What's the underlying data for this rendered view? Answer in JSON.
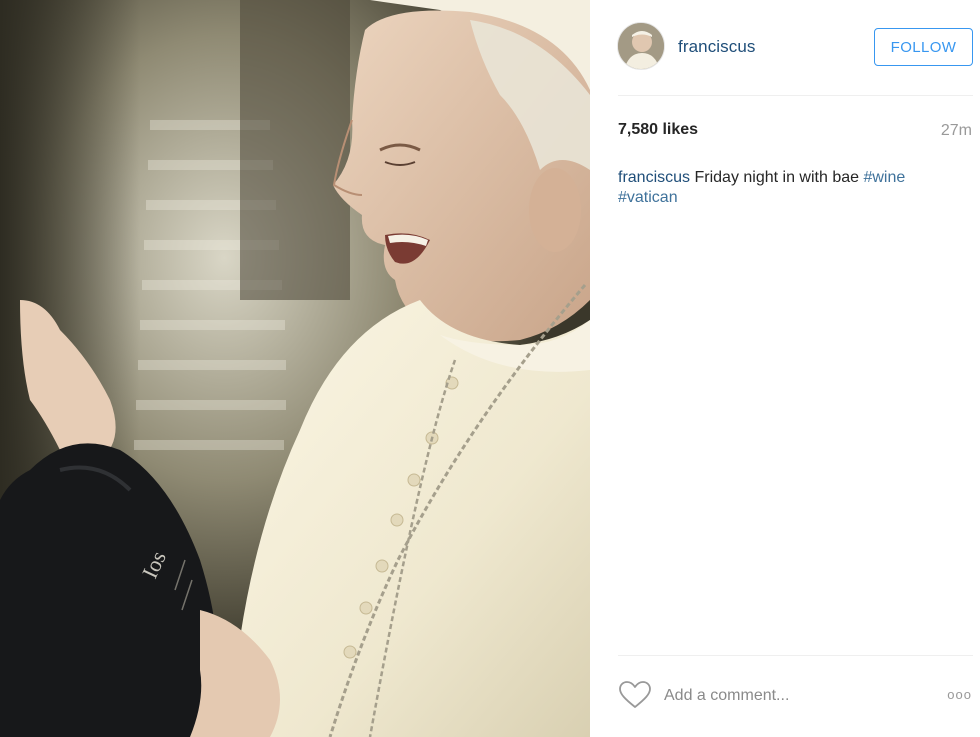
{
  "post": {
    "username": "franciscus",
    "follow_label": "FOLLOW",
    "likes": "7,580 likes",
    "time_ago": "27m",
    "caption": {
      "username": "franciscus",
      "text": "Friday night in with bae",
      "hashtags": [
        "#wine",
        "#vatican"
      ]
    },
    "comment_placeholder": "Add a comment...",
    "more_options": "ooo",
    "bottle_label": "Ios"
  },
  "icons": {
    "heart": "heart-outline-icon",
    "more": "more-options-icon"
  },
  "colors": {
    "username": "#1f4e79",
    "hashtag": "#3f729b",
    "follow": "#3897f0",
    "muted": "#999999"
  }
}
